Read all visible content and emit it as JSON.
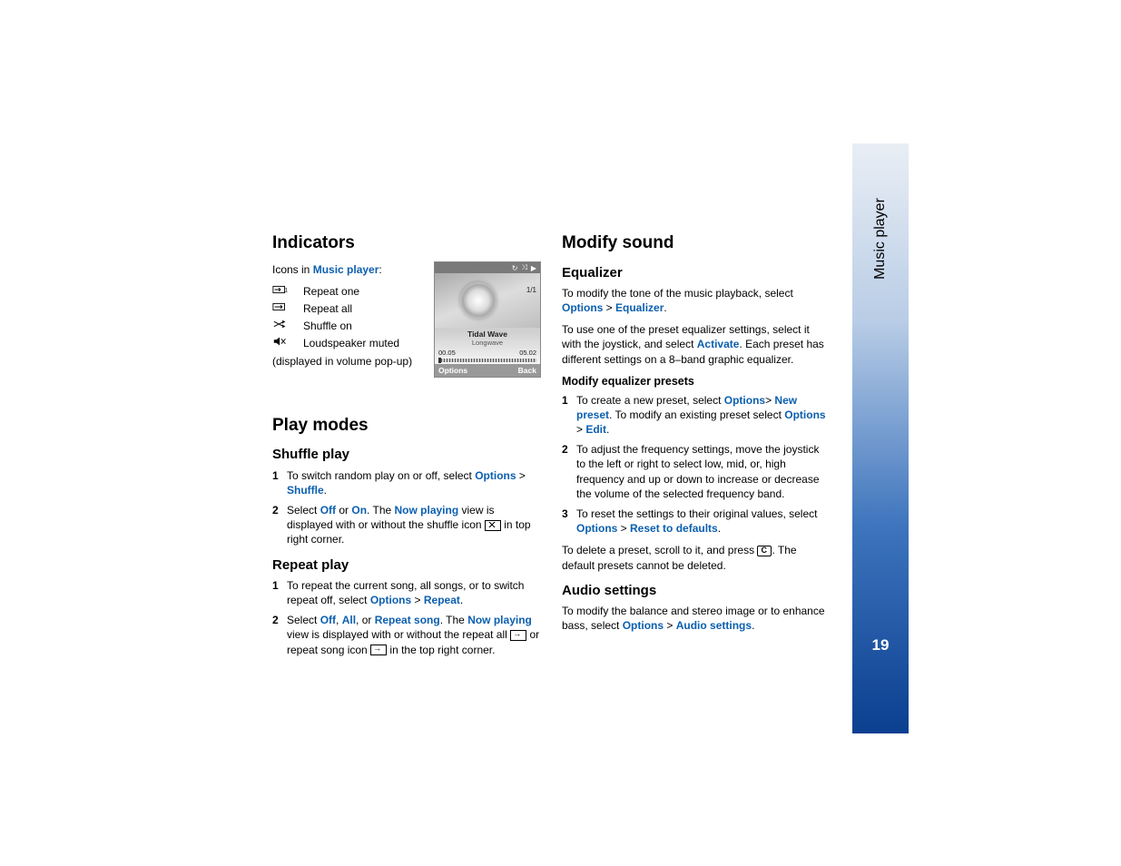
{
  "sidebar": {
    "section": "Music player",
    "page_number": "19"
  },
  "col1": {
    "h_indicators": "Indicators",
    "icons_in": "Icons in ",
    "icons_in_link": "Music player",
    "icons_in_colon": ":",
    "rows": [
      {
        "label": "Repeat one"
      },
      {
        "label": "Repeat all"
      },
      {
        "label": "Shuffle on"
      },
      {
        "label": "Loudspeaker muted"
      }
    ],
    "muted_note": "(displayed in volume pop-up)",
    "h_playmodes": "Play modes",
    "h_shuffle": "Shuffle play",
    "shuffle_steps": {
      "s1_a": "To switch random play on or off, select ",
      "s1_opt": "Options",
      "s1_gt": " > ",
      "s1_shuf": "Shuffle",
      "s1_dot": ".",
      "s2_a": "Select ",
      "s2_off": "Off",
      "s2_or": " or ",
      "s2_on": "On",
      "s2_b": ". The ",
      "s2_np": "Now playing",
      "s2_c": " view is displayed with or without the shuffle icon ",
      "s2_d": " in top right corner."
    },
    "h_repeat": "Repeat play",
    "repeat_steps": {
      "r1_a": "To repeat the current song, all songs, or to switch repeat off, select ",
      "r1_opt": "Options",
      "r1_gt": " > ",
      "r1_rep": "Repeat",
      "r1_dot": ".",
      "r2_a": "Select ",
      "r2_off": "Off",
      "r2_c1": ", ",
      "r2_all": "All",
      "r2_c2": ", or ",
      "r2_rs": "Repeat song",
      "r2_b": ". The ",
      "r2_np": "Now playing",
      "r2_c": " view is displayed with or without the repeat all ",
      "r2_d": " or repeat song icon ",
      "r2_e": " in the top right corner."
    }
  },
  "col2": {
    "h_mod": "Modify sound",
    "h_eq": "Equalizer",
    "eq_p1_a": "To modify the tone of the music playback, select ",
    "eq_p1_opt": "Options",
    "eq_p1_gt": " > ",
    "eq_p1_eq": "Equalizer",
    "eq_p1_dot": ".",
    "eq_p2_a": "To use one of the preset equalizer settings, select it with the joystick, and select ",
    "eq_p2_act": "Activate",
    "eq_p2_b": ". Each preset has different settings on a 8–band graphic equalizer.",
    "h_mep": "Modify equalizer presets",
    "mep": {
      "m1_a": "To create a new preset, select ",
      "m1_opt": "Options",
      "m1_gt1": "> ",
      "m1_np": "New preset",
      "m1_b": ". To modify an existing preset select ",
      "m1_opt2": "Options",
      "m1_gt2": " > ",
      "m1_edit": "Edit",
      "m1_dot": ".",
      "m2": "To adjust the frequency settings, move the joystick to the left or right to select low, mid, or, high frequency and up or down to increase or decrease the volume of the selected frequency band.",
      "m3_a": "To reset the settings to their original values, select ",
      "m3_opt": "Options",
      "m3_gt": " > ",
      "m3_rtd": "Reset to defaults",
      "m3_dot": "."
    },
    "del_a": "To delete a preset, scroll to it, and press ",
    "del_b": ". The default presets cannot be deleted.",
    "h_audio": "Audio settings",
    "audio_a": "To modify the balance and stereo image or to enhance bass, select ",
    "audio_opt": "Options",
    "audio_gt": " > ",
    "audio_as": "Audio settings",
    "audio_dot": "."
  },
  "shot": {
    "counter": "1/1",
    "song": "Tidal Wave",
    "artist": "Longwave",
    "elapsed": "00.05",
    "total": "05.02",
    "left": "Options",
    "right": "Back"
  }
}
